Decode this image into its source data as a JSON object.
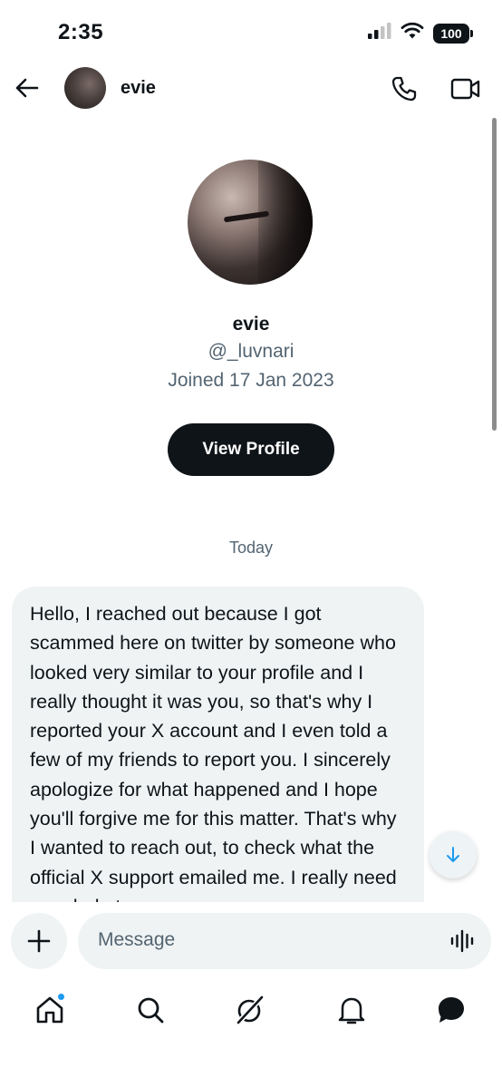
{
  "status_bar": {
    "time": "2:35",
    "battery": "100"
  },
  "header": {
    "name": "evie",
    "icons": {
      "back": "arrow-left-icon",
      "call": "phone-icon",
      "video": "video-camera-icon"
    }
  },
  "profile": {
    "name": "evie",
    "handle": "@_luvnari",
    "joined": "Joined 17 Jan 2023",
    "view_profile_label": "View Profile"
  },
  "conversation": {
    "date_divider": "Today",
    "messages": [
      {
        "direction": "incoming",
        "text": "Hello, I reached out because I got scammed here on twitter by someone who looked very similar to your profile and I really thought it was you, so that's why I reported your X account and I even told a few of my friends to report you. I sincerely apologize for what happened and I hope you'll forgive me for this matter. That's why I wanted to reach out, to check what the official X support emailed me. I really need your help to"
      }
    ]
  },
  "composer": {
    "placeholder": "Message"
  },
  "tab_bar": {
    "items": [
      "home-icon",
      "search-icon",
      "grok-icon",
      "notifications-bell-icon",
      "messages-icon"
    ]
  },
  "colors": {
    "primary_text": "#0f1419",
    "secondary_text": "#536471",
    "bubble_bg": "#eff3f4",
    "accent": "#1d9bf0"
  }
}
